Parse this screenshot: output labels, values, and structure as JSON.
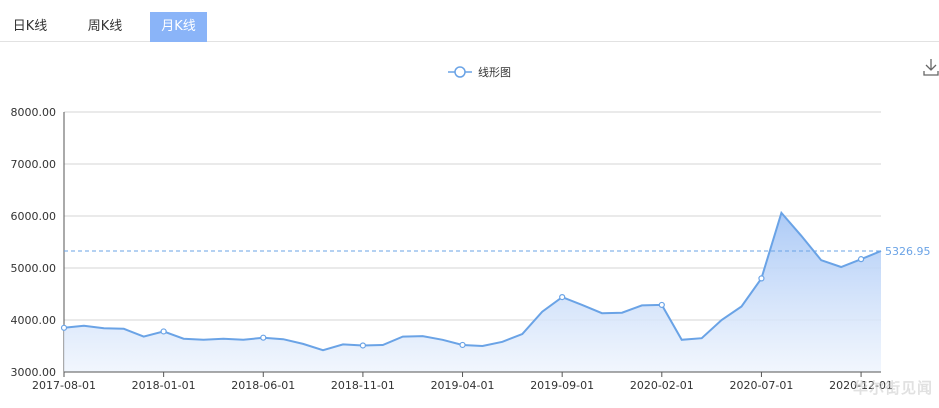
{
  "tabs": [
    {
      "label": "日K线",
      "active": false
    },
    {
      "label": "周K线",
      "active": false
    },
    {
      "label": "月K线",
      "active": true
    }
  ],
  "watermark": "华尔街见闻",
  "colors": {
    "line": "#6aa3e6",
    "fill_top": "#a9c8f6",
    "fill_bottom": "#eef4fd",
    "active_tab": "#8ab4f8",
    "grid": "#d6d6d6",
    "ref_line": "#6aa3e6"
  },
  "chart_data": {
    "type": "area",
    "legend": {
      "label": "线形图",
      "position": "top-center"
    },
    "ylim": [
      3000,
      8000
    ],
    "yticks": [
      "3000.00",
      "4000.00",
      "5000.00",
      "6000.00",
      "7000.00",
      "8000.00"
    ],
    "xticks": [
      "2017-08-01",
      "2018-01-01",
      "2018-06-01",
      "2018-11-01",
      "2019-04-01",
      "2019-09-01",
      "2020-02-01",
      "2020-07-01",
      "2020-12-01"
    ],
    "grid": true,
    "reference_line": {
      "value": 5326.95,
      "label": "5326.95"
    },
    "x": [
      "2017-08-01",
      "2017-09-01",
      "2017-10-01",
      "2017-11-01",
      "2017-12-01",
      "2018-01-01",
      "2018-02-01",
      "2018-03-01",
      "2018-04-01",
      "2018-05-01",
      "2018-06-01",
      "2018-07-01",
      "2018-08-01",
      "2018-09-01",
      "2018-10-01",
      "2018-11-01",
      "2018-12-01",
      "2019-01-01",
      "2019-02-01",
      "2019-03-01",
      "2019-04-01",
      "2019-05-01",
      "2019-06-01",
      "2019-07-01",
      "2019-08-01",
      "2019-09-01",
      "2019-10-01",
      "2019-11-01",
      "2019-12-01",
      "2020-01-01",
      "2020-02-01",
      "2020-03-01",
      "2020-04-01",
      "2020-05-01",
      "2020-06-01",
      "2020-07-01",
      "2020-08-01",
      "2020-09-01",
      "2020-10-01",
      "2020-11-01",
      "2020-12-01",
      "2021-01-01"
    ],
    "values": [
      3850,
      3890,
      3840,
      3830,
      3680,
      3780,
      3640,
      3620,
      3640,
      3620,
      3660,
      3630,
      3540,
      3420,
      3530,
      3510,
      3520,
      3680,
      3690,
      3620,
      3520,
      3500,
      3580,
      3730,
      4160,
      4440,
      4290,
      4130,
      4140,
      4280,
      4290,
      3620,
      3650,
      4000,
      4260,
      4800,
      6060,
      5620,
      5150,
      5020,
      5170,
      5326.95
    ],
    "markers": [
      "2017-08-01",
      "2018-01-01",
      "2018-06-01",
      "2018-11-01",
      "2019-04-01",
      "2019-09-01",
      "2020-02-01",
      "2020-07-01",
      "2020-12-01"
    ]
  }
}
